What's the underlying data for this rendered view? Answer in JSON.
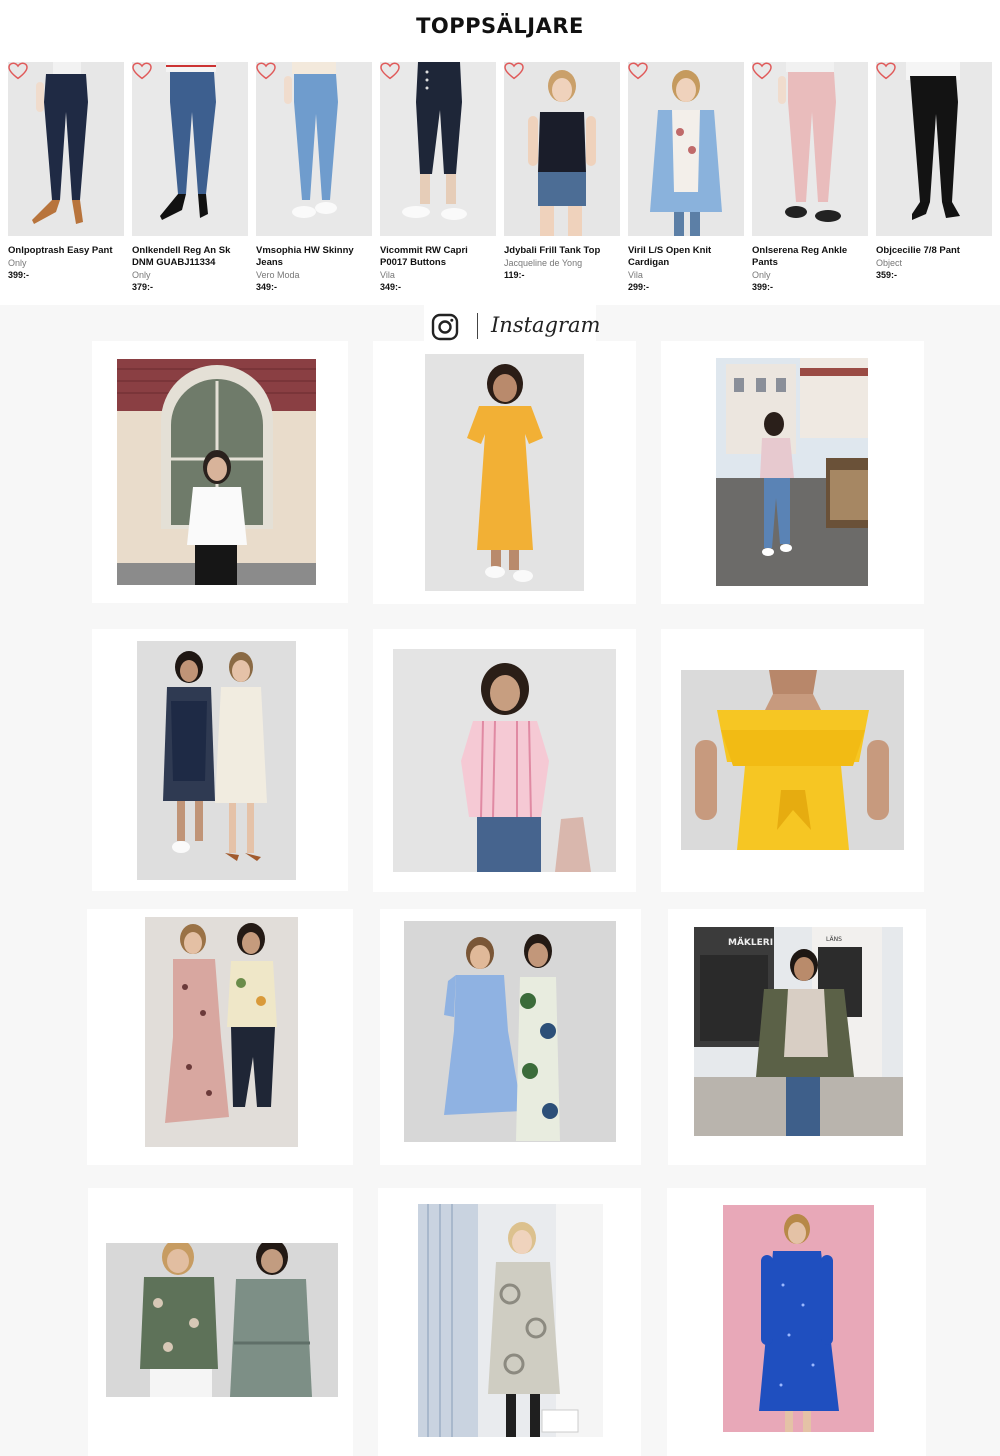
{
  "top_sellers": {
    "title": "TOPPSÄLJARE",
    "products": [
      {
        "name": "Onlpoptrash Easy Pant",
        "brand": "Only",
        "price": "399:-"
      },
      {
        "name": "Onlkendell Reg An Sk DNM GUABJ11334",
        "brand": "Only",
        "price": "379:-"
      },
      {
        "name": "Vmsophia HW Skinny Jeans",
        "brand": "Vero Moda",
        "price": "349:-"
      },
      {
        "name": "Vicommit RW Capri P0017 Buttons",
        "brand": "Vila",
        "price": "349:-"
      },
      {
        "name": "Jdybali Frill Tank Top",
        "brand": "Jacqueline de Yong",
        "price": "119:-"
      },
      {
        "name": "Viril L/S Open Knit Cardigan",
        "brand": "Vila",
        "price": "299:-"
      },
      {
        "name": "Onlserena Reg Ankle Pants",
        "brand": "Only",
        "price": "399:-"
      },
      {
        "name": "Objcecilie 7/8 Pant",
        "brand": "Object",
        "price": "359:-"
      }
    ]
  },
  "instagram": {
    "label": "Instagram",
    "posts": [
      {
        "sign_1": "",
        "sign_2": ""
      },
      {
        "sign_1": "",
        "sign_2": ""
      },
      {
        "sign_1": "",
        "sign_2": ""
      },
      {
        "sign_1": "",
        "sign_2": ""
      },
      {
        "sign_1": "",
        "sign_2": ""
      },
      {
        "sign_1": "",
        "sign_2": ""
      },
      {
        "sign_1": "",
        "sign_2": ""
      },
      {
        "sign_1": "",
        "sign_2": ""
      },
      {
        "sign_1": "MÄKLERI",
        "sign_2": "LÄNS"
      },
      {
        "sign_1": "",
        "sign_2": ""
      },
      {
        "sign_1": "",
        "sign_2": ""
      },
      {
        "sign_1": "",
        "sign_2": ""
      }
    ]
  },
  "colors": {
    "heart": "#e05a5a",
    "photo_bg": "#e6e6e6",
    "section_bg": "#f7f7f7"
  }
}
